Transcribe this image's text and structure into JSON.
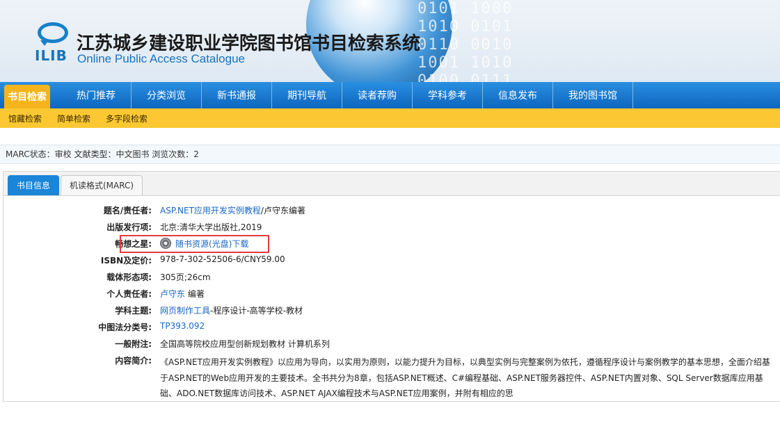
{
  "header": {
    "title": "江苏城乡建设职业学院图书馆书目检索系统",
    "subtitle": "Online Public Access Catalogue",
    "logo_text": "ILIB",
    "decor_digits": "0101 1000\n1010 0101\n0110 0010\n1001 1010\n0100 0111"
  },
  "nav": {
    "items": [
      {
        "label": "书目检索",
        "active": true
      },
      {
        "label": "热门推荐"
      },
      {
        "label": "分类浏览"
      },
      {
        "label": "新书通报"
      },
      {
        "label": "期刊导航"
      },
      {
        "label": "读者荐购"
      },
      {
        "label": "学科参考"
      },
      {
        "label": "信息发布"
      },
      {
        "label": "我的图书馆"
      }
    ]
  },
  "subnav": {
    "items": [
      "馆藏检索",
      "简单检索",
      "多字段检索"
    ]
  },
  "status": {
    "text": "MARC状态：审校  文献类型：中文图书  浏览次数：2"
  },
  "tabs": [
    {
      "label": "书目信息",
      "active": true
    },
    {
      "label": "机读格式(MARC)"
    }
  ],
  "record": {
    "title_label": "题名/责任者:",
    "title_link": "ASP.NET应用开发实例教程",
    "title_rest": "/卢守东编著",
    "pub_label": "出版发行项:",
    "pub_value": "北京:清华大学出版社,2019",
    "star_label": "畅想之星:",
    "star_link": "随书资源(光盘)下载",
    "isbn_label": "ISBN及定价:",
    "isbn_value": "978-7-302-52506-6/CNY59.00",
    "carrier_label": "载体形态项:",
    "carrier_value": "305页;26cm",
    "author_label": "个人责任者:",
    "author_link": "卢守东",
    "author_rest": " 编著",
    "subject_label": "学科主题:",
    "subject_link": "网页制作工具",
    "subject_rest": "-程序设计-高等学校-教材",
    "clc_label": "中图法分类号:",
    "clc_value": "TP393.092",
    "note_label": "一般附注:",
    "note_value": "全国高等院校应用型创新规划教材 计算机系列",
    "summary_label": "内容简介:",
    "summary_value": "《ASP.NET应用开发实例教程》以应用为导向，以实用为原则，以能力提升为目标，以典型实例与完整案例为依托，遵循程序设计与案例教学的基本思想，全面介绍基于ASP.NET的Web应用开发的主要技术。全书共分为8章，包括ASP.NET概述、C#编程基础、ASP.NET服务器控件、ASP.NET内置对象、SQL Server数据库应用基础、ADO.NET数据库访问技术、ASP.NET AJAX编程技术与ASP.NET应用案例，并附有相应的思"
  },
  "colors": {
    "nav_blue": "#0d66bf",
    "nav_active": "#f5b41c",
    "subnav": "#fbc833",
    "link": "#1a66c2",
    "highlight_box": "#e43b3b"
  }
}
